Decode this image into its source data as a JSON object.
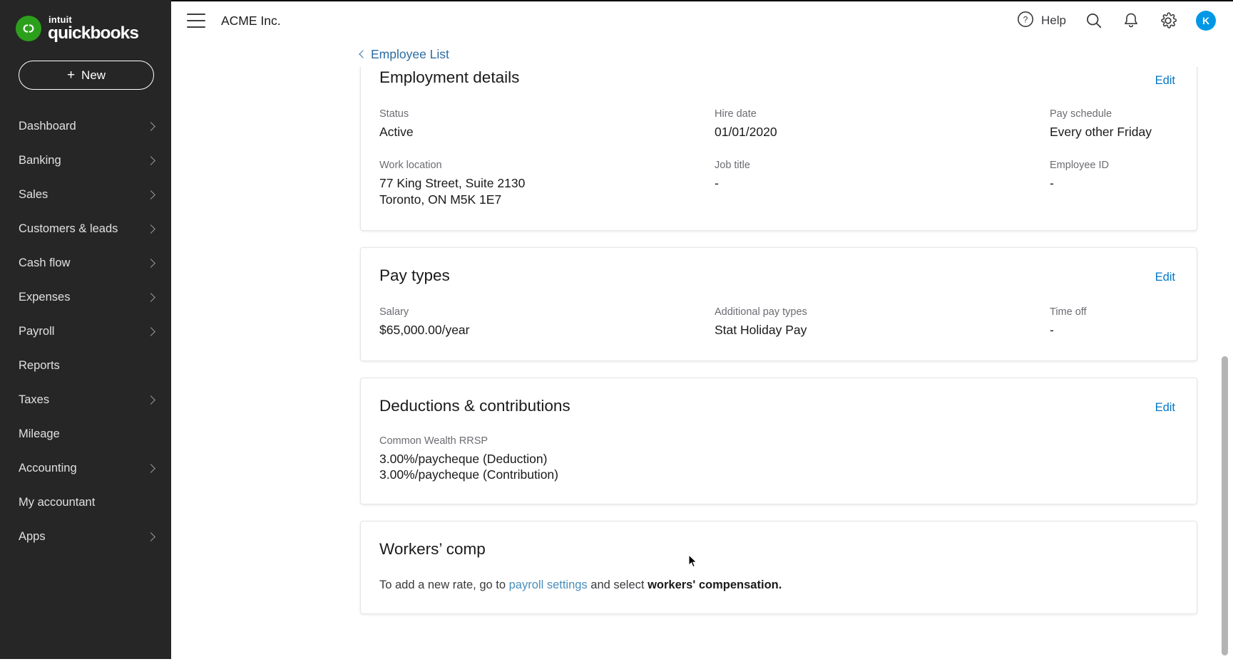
{
  "sidebar": {
    "brand": {
      "intuit": "intuit",
      "product": "quickbooks",
      "logo_icon": "quickbooks-qb-logo"
    },
    "new_button": {
      "plus": "+",
      "label": "New"
    },
    "items": [
      {
        "label": "Dashboard",
        "has_chevron": true
      },
      {
        "label": "Banking",
        "has_chevron": true
      },
      {
        "label": "Sales",
        "has_chevron": true
      },
      {
        "label": "Customers & leads",
        "has_chevron": true
      },
      {
        "label": "Cash flow",
        "has_chevron": true
      },
      {
        "label": "Expenses",
        "has_chevron": true
      },
      {
        "label": "Payroll",
        "has_chevron": true
      },
      {
        "label": "Reports",
        "has_chevron": false
      },
      {
        "label": "Taxes",
        "has_chevron": true
      },
      {
        "label": "Mileage",
        "has_chevron": false
      },
      {
        "label": "Accounting",
        "has_chevron": true
      },
      {
        "label": "My accountant",
        "has_chevron": false
      },
      {
        "label": "Apps",
        "has_chevron": true
      }
    ]
  },
  "topbar": {
    "menu_icon": "hamburger-menu-icon",
    "company": "ACME Inc.",
    "help_label": "Help",
    "help_icon": "question-mark-circle-icon",
    "search_icon": "search-icon",
    "notifications_icon": "bell-icon",
    "settings_icon": "gear-icon",
    "avatar_initial": "K"
  },
  "breadcrumb": {
    "label": "Employee List",
    "icon": "chevron-left-icon"
  },
  "cards": {
    "employment": {
      "title": "Employment details",
      "edit_label": "Edit",
      "fields": [
        {
          "label": "Status",
          "value": "Active"
        },
        {
          "label": "Hire date",
          "value": "01/01/2020"
        },
        {
          "label": "Pay schedule",
          "value": "Every other Friday"
        },
        {
          "label": "Work location",
          "value": "77 King Street, Suite 2130\nToronto, ON M5K 1E7"
        },
        {
          "label": "Job title",
          "value": "-"
        },
        {
          "label": "Employee ID",
          "value": "-"
        }
      ]
    },
    "pay_types": {
      "title": "Pay types",
      "edit_label": "Edit",
      "fields": [
        {
          "label": "Salary",
          "value": "$65,000.00/year"
        },
        {
          "label": "Additional pay types",
          "value": "Stat Holiday Pay"
        },
        {
          "label": "Time off",
          "value": "-"
        }
      ]
    },
    "deductions": {
      "title": "Deductions & contributions",
      "edit_label": "Edit",
      "plan_label": "Common Wealth RRSP",
      "line1": "3.00%/paycheque (Deduction)",
      "line2": "3.00%/paycheque (Contribution)"
    },
    "workers_comp": {
      "title": "Workers’ comp",
      "text_before": "To add a new rate, go to ",
      "link": "payroll settings",
      "text_middle": " and select ",
      "bold": "workers' compensation."
    }
  },
  "colors": {
    "sidebar_bg": "#262626",
    "brand_green": "#2ca01c",
    "link_blue": "#0077c5",
    "breadcrumb_blue": "#2c6ca4",
    "avatar_blue": "#0097e6"
  },
  "scrollbar": {
    "name": "vertical-scrollbar"
  }
}
